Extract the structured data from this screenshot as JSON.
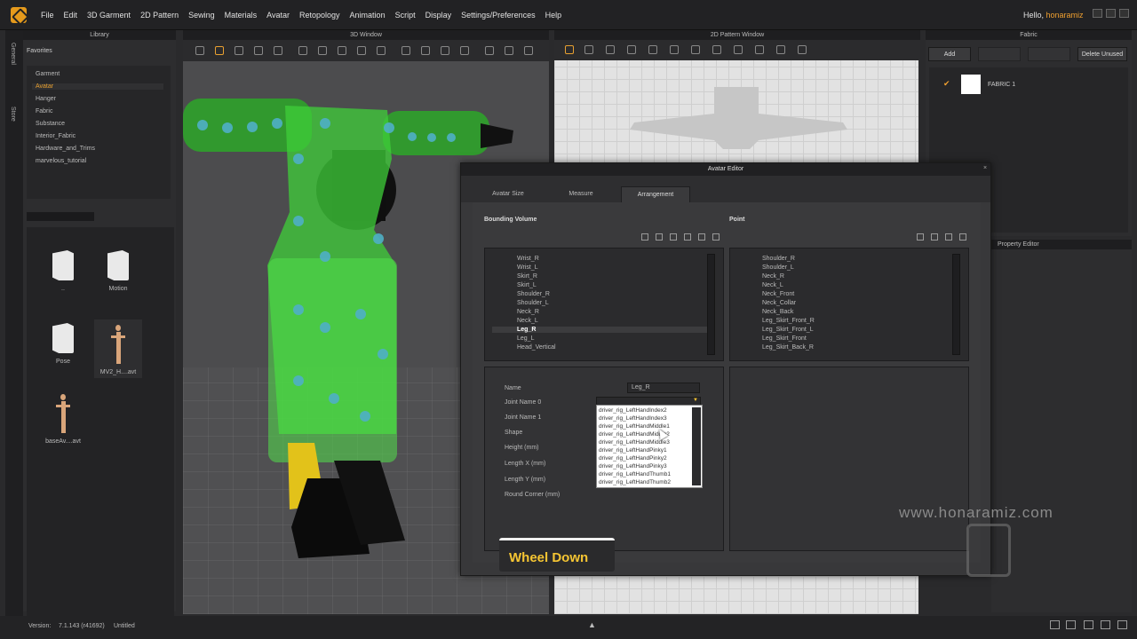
{
  "menu": [
    "File",
    "Edit",
    "3D Garment",
    "2D Pattern",
    "Sewing",
    "Materials",
    "Avatar",
    "Retopology",
    "Animation",
    "Script",
    "Display",
    "Settings/Preferences",
    "Help"
  ],
  "user": {
    "greeting": "Hello,",
    "name": "honaramiz"
  },
  "sidebar": {
    "tabs": [
      "General",
      "Store"
    ]
  },
  "library": {
    "title": "Library",
    "favorites_label": "Favorites",
    "favorites": [
      "Garment",
      "Avatar",
      "Hanger",
      "Fabric",
      "Substance",
      "Interior_Fabric",
      "Hardware_and_Trims",
      "marvelous_tutorial"
    ],
    "selected_favorite": "Avatar",
    "items": [
      {
        "label": "..",
        "icon": "folder-icon"
      },
      {
        "label": "Motion",
        "icon": "folder-icon"
      },
      {
        "label": "Pose",
        "icon": "folder-icon"
      },
      {
        "label": "MV2_H....avt",
        "icon": "avatar-icon"
      },
      {
        "label": "baseAv....avt",
        "icon": "avatar-icon"
      }
    ]
  },
  "window3d": {
    "title": "3D Window"
  },
  "window2d": {
    "title": "2D Pattern Window"
  },
  "fabric": {
    "title": "Fabric",
    "buttons": {
      "add": "Add",
      "delete_unused": "Delete Unused"
    },
    "items": [
      {
        "name": "FABRIC 1",
        "checked": true,
        "swatch": "#ffffff"
      }
    ]
  },
  "property_editor": {
    "title": "Property Editor"
  },
  "avatar_editor": {
    "title": "Avatar Editor",
    "tabs": [
      "Avatar Size",
      "Measure",
      "Arrangement"
    ],
    "active_tab": "Arrangement",
    "bounding_volume": {
      "title": "Bounding Volume",
      "items": [
        "Wrist_R",
        "Wrist_L",
        "Skirt_R",
        "Skirt_L",
        "Shoulder_R",
        "Shoulder_L",
        "Neck_R",
        "Neck_L",
        "Leg_R",
        "Leg_L",
        "Head_Vertical"
      ],
      "selected": "Leg_R"
    },
    "point": {
      "title": "Point",
      "items": [
        "Shoulder_R",
        "Shoulder_L",
        "Neck_R",
        "Neck_L",
        "Neck_Front",
        "Neck_Collar",
        "Neck_Back",
        "Leg_Skirt_Front_R",
        "Leg_Skirt_Front_L",
        "Leg_Skirt_Front",
        "Leg_Skirt_Back_R"
      ]
    },
    "properties": {
      "labels": [
        "Name",
        "Joint Name 0",
        "Joint Name 1",
        "Shape",
        "Height (mm)",
        "Length X (mm)",
        "Length Y (mm)",
        "Round Corner (mm)"
      ],
      "name_value": "Leg_R"
    },
    "joint_dropdown": [
      "driver_rig_LeftHandIndex2",
      "driver_rig_LeftHandIndex3",
      "driver_rig_LeftHandMiddle1",
      "driver_rig_LeftHandMiddle2",
      "driver_rig_LeftHandMiddle3",
      "driver_rig_LeftHandPinky1",
      "driver_rig_LeftHandPinky2",
      "driver_rig_LeftHandPinky3",
      "driver_rig_LeftHandThumb1",
      "driver_rig_LeftHandThumb2"
    ]
  },
  "overlay": {
    "key_hint": "Wheel Down",
    "watermark": "www.honaramiz.com"
  },
  "status": {
    "version_label": "Version:",
    "version": "7.1.143 (r41692)",
    "file": "Untitled"
  },
  "colors": {
    "accent": "#f0a030",
    "garment_green": "#3fcf3a",
    "hint_yellow": "#f5c533"
  }
}
